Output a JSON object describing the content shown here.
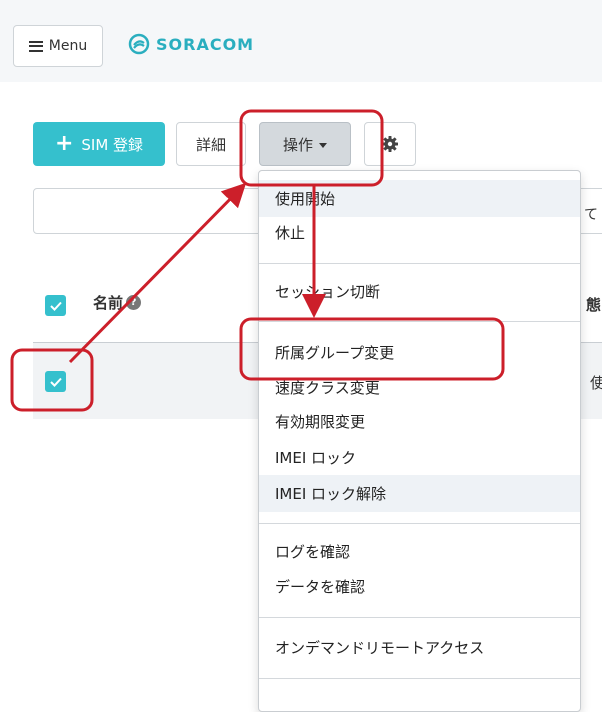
{
  "header": {
    "menu_label": "Menu",
    "logo_text": "SORACOM",
    "brand_color": "#2aaebf"
  },
  "toolbar": {
    "add_label": "SIM 登録",
    "detail_label": "詳細",
    "operations_label": "操作",
    "settings_icon": "gear-icon"
  },
  "search": {
    "value": "",
    "trailing_text": "て"
  },
  "table": {
    "name_header": "名前",
    "right_header_partial": "態",
    "row_partial_text": "使"
  },
  "dropdown": {
    "groups": [
      [
        "使用開始",
        "休止"
      ],
      [
        "セッション切断"
      ],
      [
        "所属グループ変更",
        "速度クラス変更",
        "有効期限変更",
        "IMEI ロック",
        "IMEI ロック解除"
      ],
      [
        "ログを確認",
        "データを確認"
      ],
      [
        "オンデマンドリモートアクセス"
      ]
    ],
    "highlighted": [
      "使用開始",
      "IMEI ロック解除"
    ]
  },
  "annotation_color": "#cc1f2a",
  "accent_color": "#35c0cd"
}
